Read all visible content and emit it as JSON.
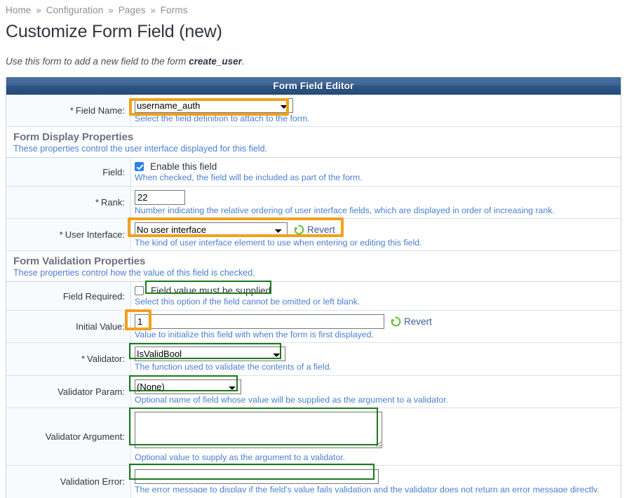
{
  "breadcrumb": {
    "separator": "»",
    "items": [
      "Home",
      "Configuration",
      "Pages",
      "Forms"
    ]
  },
  "page_title": "Customize Form Field (new)",
  "intro": {
    "prefix": "Use this form to add a new field to the form ",
    "form_name": "create_user",
    "suffix": "."
  },
  "table_header": "Form Field Editor",
  "sections": {
    "display": {
      "title": "Form Display Properties",
      "desc": "These properties control the user interface displayed for this field."
    },
    "validation": {
      "title": "Form Validation Properties",
      "desc": "These properties control how the value of this field is checked."
    }
  },
  "fields": {
    "field_name": {
      "label": "Field Name:",
      "required_mark": "*",
      "value": "username_auth",
      "help": "Select the field definition to attach to the form.",
      "highlight": "orange"
    },
    "field_enable": {
      "label": "Field:",
      "required_mark": "",
      "checkbox_label": "Enable this field",
      "checked": true,
      "help": "When checked, the field will be included as part of the form."
    },
    "rank": {
      "label": "Rank:",
      "required_mark": "*",
      "value": "22",
      "help": "Number indicating the relative ordering of user interface fields, which are displayed in order of increasing rank."
    },
    "user_interface": {
      "label": "User Interface:",
      "required_mark": "*",
      "value": "No user interface",
      "revert_label": "Revert",
      "help": "The kind of user interface element to use when entering or editing this field.",
      "highlight": "orange"
    },
    "field_required": {
      "label": "Field Required:",
      "required_mark": "",
      "checkbox_label": "Field value must be supplied",
      "checked": false,
      "help": "Select this option if the field cannot be omitted or left blank.",
      "highlight": "green"
    },
    "initial_value": {
      "label": "Initial Value:",
      "required_mark": "",
      "value": "1",
      "revert_label": "Revert",
      "help": "Value to initialize this field with when the form is first displayed.",
      "highlight": "orange"
    },
    "validator": {
      "label": "Validator:",
      "required_mark": "*",
      "value": "IsValidBool",
      "help": "The function used to validate the contents of a field.",
      "highlight": "green"
    },
    "validator_param": {
      "label": "Validator Param:",
      "required_mark": "",
      "value": "(None)",
      "help": "Optional name of field whose value will be supplied as the argument to a validator.",
      "highlight": "green"
    },
    "validator_argument": {
      "label": "Validator Argument:",
      "required_mark": "",
      "value": "",
      "help": "Optional value to supply as the argument to a validator.",
      "highlight": "green"
    },
    "validation_error": {
      "label": "Validation Error:",
      "required_mark": "",
      "value": "",
      "help": "The error message to display if the field's value fails validation and the validator does not return an error message directly.",
      "highlight": "green"
    }
  },
  "colors": {
    "header_blue": "#2e5585",
    "help_link_blue": "#4a7fd0",
    "highlight_orange": "#f0a11b",
    "highlight_green": "#1a7a1a",
    "checkbox_blue": "#2d7ff0",
    "revert_green": "#6cbf3f"
  },
  "icons": {
    "revert": "revert-circular-arrow-icon",
    "dropdown": "chevron-down-icon"
  }
}
